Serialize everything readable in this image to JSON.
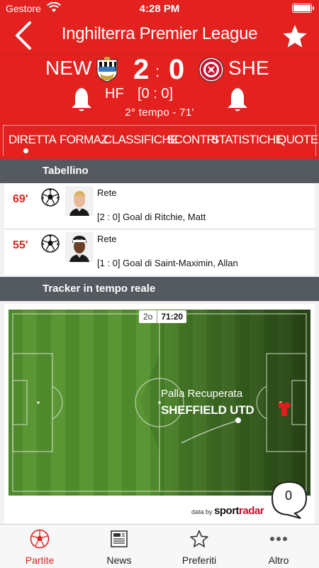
{
  "status_bar": {
    "carrier": "Gestore",
    "time": "4:28 PM"
  },
  "header": {
    "title": "Inghilterra Premier League"
  },
  "match": {
    "home_team": "NEW",
    "away_team": "SHE",
    "home_score": "2",
    "away_score": "0",
    "separator": ":",
    "half_time_label": "HF",
    "half_time_score": "[0 : 0]",
    "status": "2° tempo - 71'"
  },
  "tabs": [
    {
      "label": "DIRETTA",
      "active": true
    },
    {
      "label": "FORMAZ.",
      "active": false
    },
    {
      "label": "CLASSIFICHE",
      "active": false
    },
    {
      "label": "SCONTRI",
      "active": false
    },
    {
      "label": "STATISTICHE",
      "active": false
    },
    {
      "label": "QUOTE",
      "active": false
    }
  ],
  "scorers_section": {
    "title": "Tabellino",
    "events": [
      {
        "minute": "69'",
        "type": "Rete",
        "description": "[2 : 0] Goal di Ritchie, Matt"
      },
      {
        "minute": "55'",
        "type": "Rete",
        "description": "[1 : 0] Goal di Saint-Maximin, Allan"
      }
    ]
  },
  "tracker_section": {
    "title": "Tracker in tempo reale",
    "half": "2o",
    "clock": "71:20",
    "event_caption": "Palla Recuperata",
    "event_team": "SHEFFIELD UTD",
    "attribution_prefix": "data by",
    "attribution_brand_a": "sport",
    "attribution_brand_b": "radar"
  },
  "comments": {
    "count": "0"
  },
  "bottom_tabs": [
    {
      "label": "Partite",
      "icon": "soccer-ball-icon",
      "active": true
    },
    {
      "label": "News",
      "icon": "newspaper-icon",
      "active": false
    },
    {
      "label": "Preferiti",
      "icon": "star-outline-icon",
      "active": false
    },
    {
      "label": "Altro",
      "icon": "more-dots-icon",
      "active": false
    }
  ],
  "colors": {
    "accent": "#e3211f",
    "section_header": "#555a60",
    "pitch_green": "#4c8a2a"
  }
}
